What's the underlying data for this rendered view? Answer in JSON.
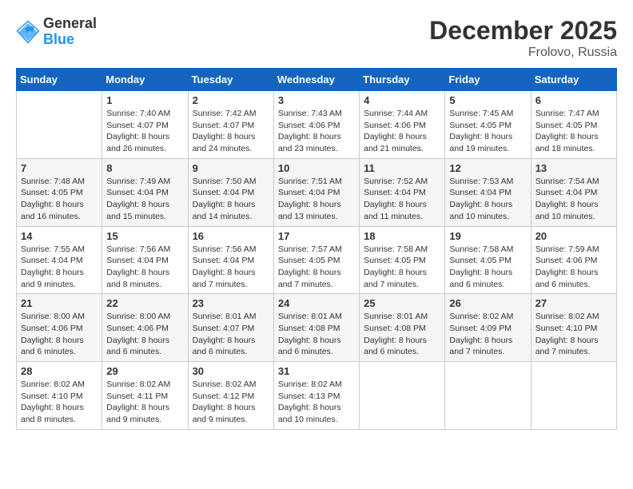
{
  "logo": {
    "general": "General",
    "blue": "Blue"
  },
  "title": "December 2025",
  "subtitle": "Frolovo, Russia",
  "days_of_week": [
    "Sunday",
    "Monday",
    "Tuesday",
    "Wednesday",
    "Thursday",
    "Friday",
    "Saturday"
  ],
  "weeks": [
    [
      {
        "number": "",
        "info": ""
      },
      {
        "number": "1",
        "info": "Sunrise: 7:40 AM\nSunset: 4:07 PM\nDaylight: 8 hours\nand 26 minutes."
      },
      {
        "number": "2",
        "info": "Sunrise: 7:42 AM\nSunset: 4:07 PM\nDaylight: 8 hours\nand 24 minutes."
      },
      {
        "number": "3",
        "info": "Sunrise: 7:43 AM\nSunset: 4:06 PM\nDaylight: 8 hours\nand 23 minutes."
      },
      {
        "number": "4",
        "info": "Sunrise: 7:44 AM\nSunset: 4:06 PM\nDaylight: 8 hours\nand 21 minutes."
      },
      {
        "number": "5",
        "info": "Sunrise: 7:45 AM\nSunset: 4:05 PM\nDaylight: 8 hours\nand 19 minutes."
      },
      {
        "number": "6",
        "info": "Sunrise: 7:47 AM\nSunset: 4:05 PM\nDaylight: 8 hours\nand 18 minutes."
      }
    ],
    [
      {
        "number": "7",
        "info": "Sunrise: 7:48 AM\nSunset: 4:05 PM\nDaylight: 8 hours\nand 16 minutes."
      },
      {
        "number": "8",
        "info": "Sunrise: 7:49 AM\nSunset: 4:04 PM\nDaylight: 8 hours\nand 15 minutes."
      },
      {
        "number": "9",
        "info": "Sunrise: 7:50 AM\nSunset: 4:04 PM\nDaylight: 8 hours\nand 14 minutes."
      },
      {
        "number": "10",
        "info": "Sunrise: 7:51 AM\nSunset: 4:04 PM\nDaylight: 8 hours\nand 13 minutes."
      },
      {
        "number": "11",
        "info": "Sunrise: 7:52 AM\nSunset: 4:04 PM\nDaylight: 8 hours\nand 11 minutes."
      },
      {
        "number": "12",
        "info": "Sunrise: 7:53 AM\nSunset: 4:04 PM\nDaylight: 8 hours\nand 10 minutes."
      },
      {
        "number": "13",
        "info": "Sunrise: 7:54 AM\nSunset: 4:04 PM\nDaylight: 8 hours\nand 10 minutes."
      }
    ],
    [
      {
        "number": "14",
        "info": "Sunrise: 7:55 AM\nSunset: 4:04 PM\nDaylight: 8 hours\nand 9 minutes."
      },
      {
        "number": "15",
        "info": "Sunrise: 7:56 AM\nSunset: 4:04 PM\nDaylight: 8 hours\nand 8 minutes."
      },
      {
        "number": "16",
        "info": "Sunrise: 7:56 AM\nSunset: 4:04 PM\nDaylight: 8 hours\nand 7 minutes."
      },
      {
        "number": "17",
        "info": "Sunrise: 7:57 AM\nSunset: 4:05 PM\nDaylight: 8 hours\nand 7 minutes."
      },
      {
        "number": "18",
        "info": "Sunrise: 7:58 AM\nSunset: 4:05 PM\nDaylight: 8 hours\nand 7 minutes."
      },
      {
        "number": "19",
        "info": "Sunrise: 7:58 AM\nSunset: 4:05 PM\nDaylight: 8 hours\nand 6 minutes."
      },
      {
        "number": "20",
        "info": "Sunrise: 7:59 AM\nSunset: 4:06 PM\nDaylight: 8 hours\nand 6 minutes."
      }
    ],
    [
      {
        "number": "21",
        "info": "Sunrise: 8:00 AM\nSunset: 4:06 PM\nDaylight: 8 hours\nand 6 minutes."
      },
      {
        "number": "22",
        "info": "Sunrise: 8:00 AM\nSunset: 4:06 PM\nDaylight: 8 hours\nand 6 minutes."
      },
      {
        "number": "23",
        "info": "Sunrise: 8:01 AM\nSunset: 4:07 PM\nDaylight: 8 hours\nand 6 minutes."
      },
      {
        "number": "24",
        "info": "Sunrise: 8:01 AM\nSunset: 4:08 PM\nDaylight: 8 hours\nand 6 minutes."
      },
      {
        "number": "25",
        "info": "Sunrise: 8:01 AM\nSunset: 4:08 PM\nDaylight: 8 hours\nand 6 minutes."
      },
      {
        "number": "26",
        "info": "Sunrise: 8:02 AM\nSunset: 4:09 PM\nDaylight: 8 hours\nand 7 minutes."
      },
      {
        "number": "27",
        "info": "Sunrise: 8:02 AM\nSunset: 4:10 PM\nDaylight: 8 hours\nand 7 minutes."
      }
    ],
    [
      {
        "number": "28",
        "info": "Sunrise: 8:02 AM\nSunset: 4:10 PM\nDaylight: 8 hours\nand 8 minutes."
      },
      {
        "number": "29",
        "info": "Sunrise: 8:02 AM\nSunset: 4:11 PM\nDaylight: 8 hours\nand 9 minutes."
      },
      {
        "number": "30",
        "info": "Sunrise: 8:02 AM\nSunset: 4:12 PM\nDaylight: 8 hours\nand 9 minutes."
      },
      {
        "number": "31",
        "info": "Sunrise: 8:02 AM\nSunset: 4:13 PM\nDaylight: 8 hours\nand 10 minutes."
      },
      {
        "number": "",
        "info": ""
      },
      {
        "number": "",
        "info": ""
      },
      {
        "number": "",
        "info": ""
      }
    ]
  ]
}
